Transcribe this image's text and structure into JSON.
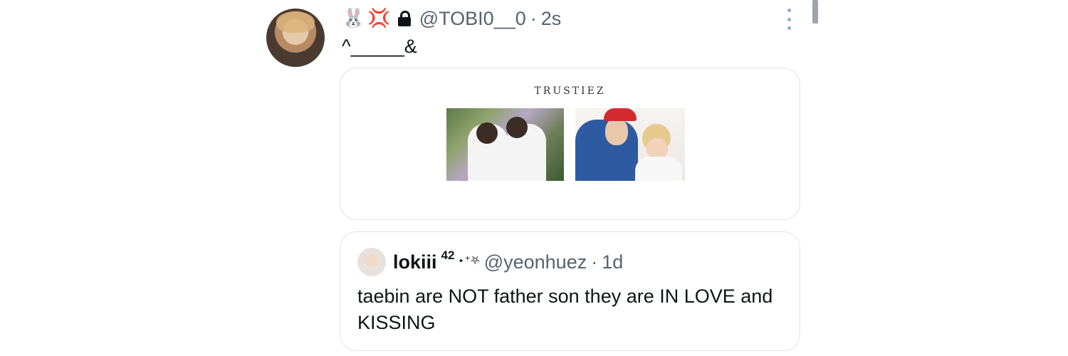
{
  "tweet": {
    "emoji_1": "🐰",
    "emoji_2": "💢",
    "handle": "@TOBI0__0",
    "separator": "·",
    "time": "2s",
    "text": "^_____&",
    "card_brand": "TRUSTIEZ"
  },
  "quote": {
    "name": "lokiii",
    "badge": "42",
    "decor": "⋆⁺⛧",
    "handle": "@yeonhuez",
    "separator": "·",
    "time": "1d",
    "text": "taebin are NOT father son they are IN LOVE and KISSING"
  },
  "icons": [
    "avatar",
    "rabbit-icon",
    "anger-icon",
    "lock-icon",
    "more-options-icon"
  ],
  "colors": {
    "text": "#0f1419",
    "secondary": "#536471",
    "border": "#dfe3e6",
    "more_dots": "#8ab0c8"
  }
}
